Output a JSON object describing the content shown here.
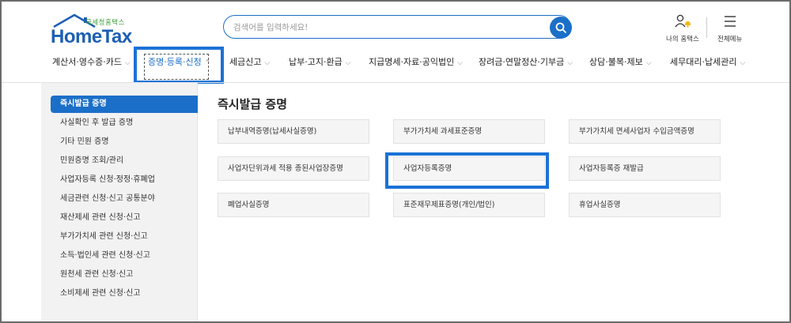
{
  "header": {
    "logo_sub": "국세청홈택스",
    "logo_main": "HomeTax",
    "search_placeholder": "검색어를 입력하세요!",
    "my_hometax_label": "나의 홈택스",
    "all_menu_label": "전체메뉴"
  },
  "nav": {
    "items": [
      {
        "label": "계산서·영수증·카드"
      },
      {
        "label": "증명·등록·신청"
      },
      {
        "label": "세금신고"
      },
      {
        "label": "납부·고지·환급"
      },
      {
        "label": "지급명세·자료·공익법인"
      },
      {
        "label": "장려금·연말정산·기부금"
      },
      {
        "label": "상담·불복·제보"
      },
      {
        "label": "세무대리·납세관리"
      }
    ],
    "active_index": 1
  },
  "sidebar": {
    "items": [
      {
        "label": "즉시발급 증명"
      },
      {
        "label": "사실확인 후 발급 증명"
      },
      {
        "label": "기타 민원 증명"
      },
      {
        "label": "민원증명 조회/관리"
      },
      {
        "label": "사업자등록 신청·정정·휴폐업"
      },
      {
        "label": "세금관련 신청·신고 공통분야"
      },
      {
        "label": "재산제세 관련 신청·신고"
      },
      {
        "label": "부가가치세 관련 신청·신고"
      },
      {
        "label": "소득·법인세 관련 신청·신고"
      },
      {
        "label": "원천세 관련 신청·신고"
      },
      {
        "label": "소비제세 관련 신청·신고"
      }
    ],
    "active_index": 0
  },
  "main": {
    "title": "즉시발급 증명",
    "cards": [
      {
        "label": "납부내역증명(납세사실증명)"
      },
      {
        "label": "부가가치세 과세표준증명"
      },
      {
        "label": "부가가치세 면세사업자 수입금액증명"
      },
      {
        "label": "사업자단위과세 적용 종된사업장증명"
      },
      {
        "label": "사업자등록증명"
      },
      {
        "label": "사업자등록증 재발급"
      },
      {
        "label": "폐업사실증명"
      },
      {
        "label": "표준재무제표증명(개인/법인)"
      },
      {
        "label": "휴업사실증명"
      }
    ],
    "highlighted_index": 4
  },
  "colors": {
    "accent": "#1b6fc8",
    "highlight_box": "#1b72d6",
    "logo_green": "#3a9a3a"
  },
  "icons": {
    "search": "search-icon",
    "my_hometax": "user-bell-icon",
    "all_menu": "hamburger-menu-icon",
    "chevron": "chevron-down-icon",
    "logo_roof": "house-roof-icon"
  }
}
